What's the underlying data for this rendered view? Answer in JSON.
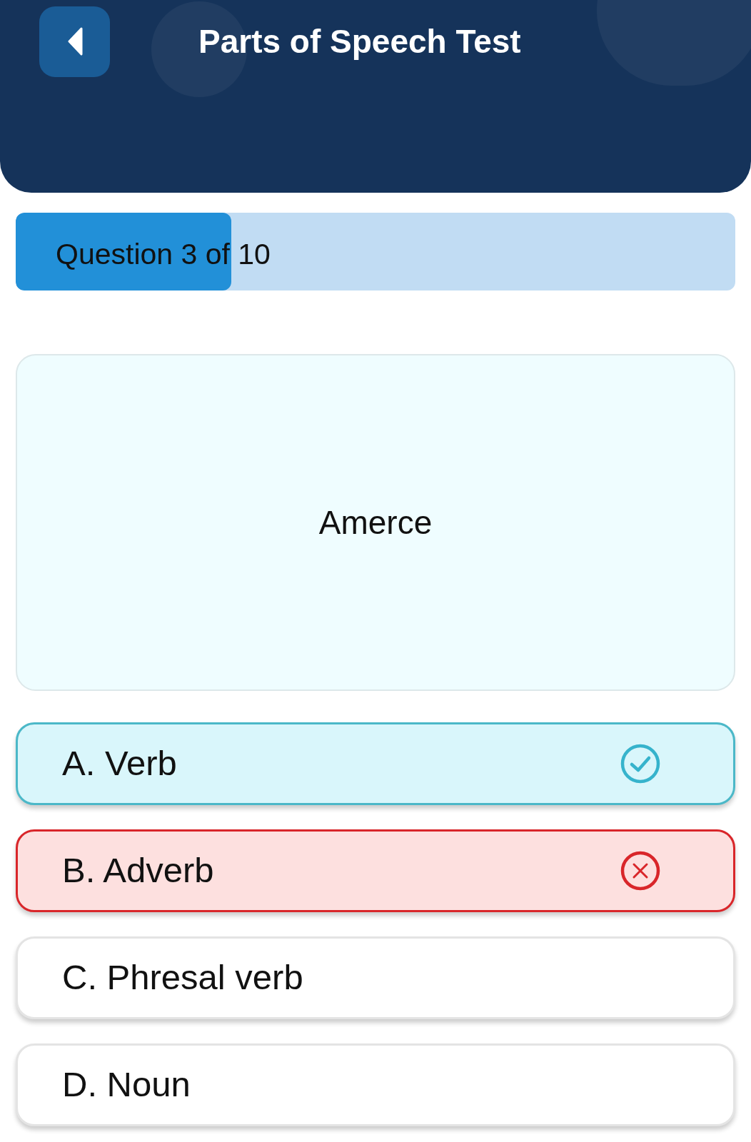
{
  "header": {
    "title": "Parts of Speech Test"
  },
  "progress": {
    "label": "Question 3 of 10",
    "level": 0.3
  },
  "question": {
    "word": "Amerce"
  },
  "options": [
    {
      "label": "A. Verb",
      "kind": "correct"
    },
    {
      "label": "B. Adverb",
      "kind": "wrong"
    },
    {
      "label": "C. Phresal verb",
      "kind": "plain"
    },
    {
      "label": "D. Noun",
      "kind": "plain"
    }
  ]
}
